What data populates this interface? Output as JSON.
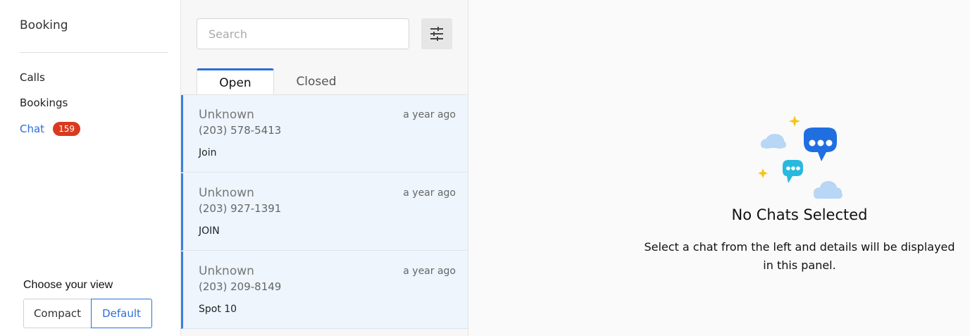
{
  "sidebar": {
    "title": "Booking",
    "items": [
      {
        "label": "Calls"
      },
      {
        "label": "Bookings"
      },
      {
        "label": "Chat",
        "badge": "159"
      }
    ],
    "view_label": "Choose your view",
    "view_options": [
      "Compact",
      "Default"
    ],
    "view_selected": "Default"
  },
  "list": {
    "search_placeholder": "Search",
    "tabs": [
      "Open",
      "Closed"
    ],
    "active_tab": "Open",
    "chats": [
      {
        "name": "Unknown",
        "time": "a year ago",
        "phone": "(203) 578-5413",
        "message": "Join"
      },
      {
        "name": "Unknown",
        "time": "a year ago",
        "phone": "(203) 927-1391",
        "message": "JOIN"
      },
      {
        "name": "Unknown",
        "time": "a year ago",
        "phone": "(203) 209-8149",
        "message": "Spot 10"
      }
    ]
  },
  "detail": {
    "empty_title": "No Chats Selected",
    "empty_text": "Select a chat from the left and details will be displayed in this panel."
  },
  "colors": {
    "accent": "#2a6fd6",
    "badge": "#d93a1f",
    "selected_row": "#eef5fd"
  }
}
